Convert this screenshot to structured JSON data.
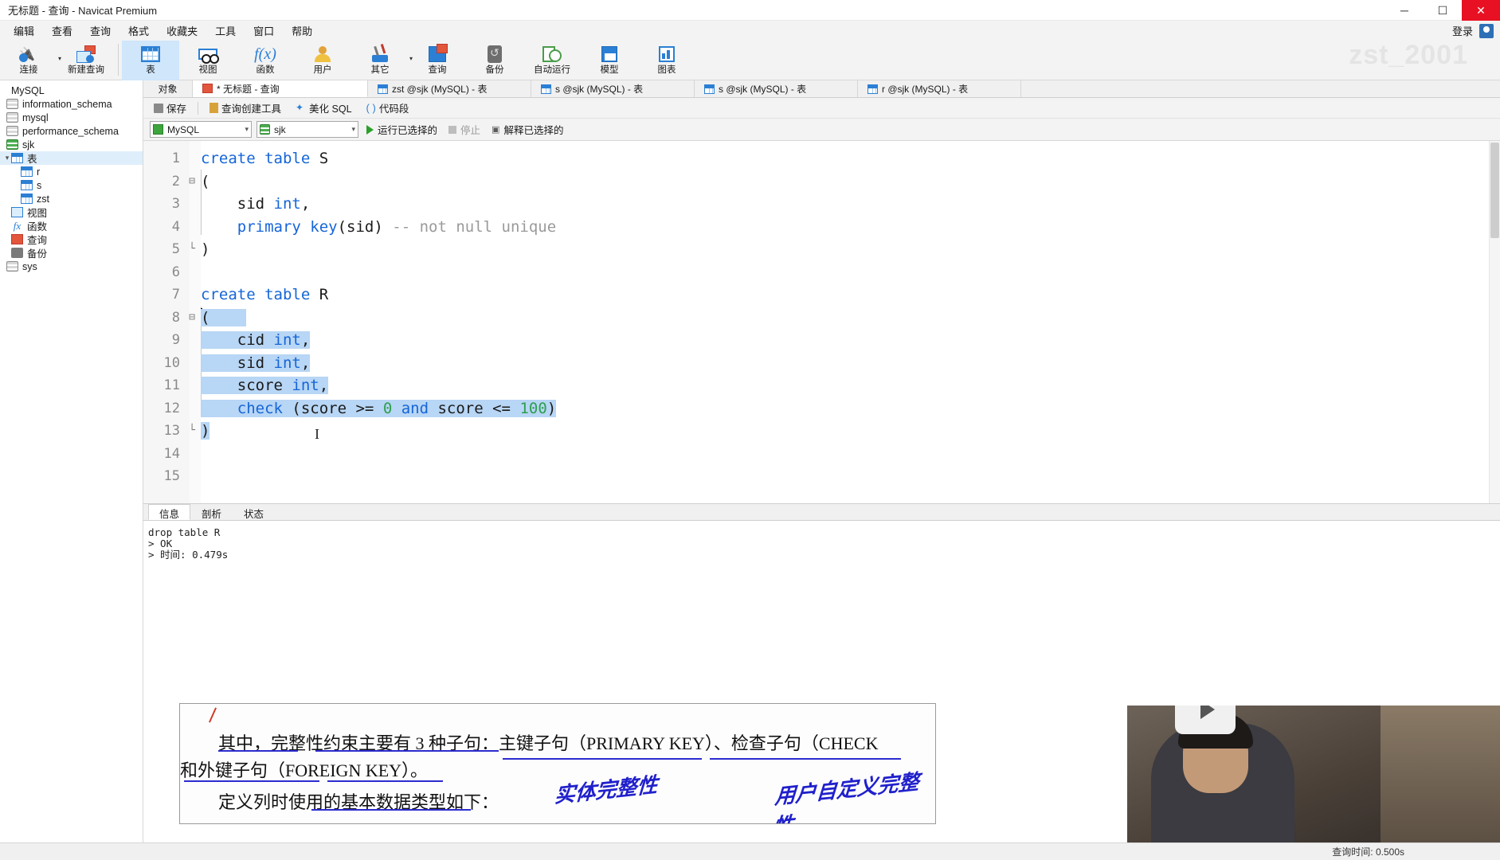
{
  "window": {
    "title": "无标题 - 查询 - Navicat Premium",
    "minimize": "─",
    "maximize": "☐",
    "close": "✕"
  },
  "menubar": {
    "items": [
      "编辑",
      "查看",
      "查询",
      "格式",
      "收藏夹",
      "工具",
      "窗口",
      "帮助"
    ],
    "login_label": "登录"
  },
  "ribbon": {
    "watermark": "zst_2001",
    "buttons": [
      {
        "label": "连接",
        "icon": "connection-icon",
        "has_caret": true
      },
      {
        "label": "新建查询",
        "icon": "new-query-icon",
        "has_caret": false
      },
      {
        "label": "表",
        "icon": "table-icon",
        "has_caret": false,
        "active": true
      },
      {
        "label": "视图",
        "icon": "view-icon",
        "has_caret": false
      },
      {
        "label": "函数",
        "icon": "function-icon",
        "has_caret": false
      },
      {
        "label": "用户",
        "icon": "user-icon",
        "has_caret": false
      },
      {
        "label": "其它",
        "icon": "other-icon",
        "has_caret": true
      },
      {
        "label": "查询",
        "icon": "query-icon",
        "has_caret": false
      },
      {
        "label": "备份",
        "icon": "backup-icon",
        "has_caret": false
      },
      {
        "label": "自动运行",
        "icon": "automation-icon",
        "has_caret": false
      },
      {
        "label": "模型",
        "icon": "model-icon",
        "has_caret": false
      },
      {
        "label": "图表",
        "icon": "chart-icon",
        "has_caret": false
      }
    ]
  },
  "sidebar": {
    "items": [
      {
        "label": "MySQL",
        "icon": "connection-icon",
        "indent": 0,
        "expander": ""
      },
      {
        "label": "information_schema",
        "icon": "database-icon",
        "indent": 1,
        "expander": ""
      },
      {
        "label": "mysql",
        "icon": "database-icon",
        "indent": 1,
        "expander": ""
      },
      {
        "label": "performance_schema",
        "icon": "database-icon",
        "indent": 1,
        "expander": ""
      },
      {
        "label": "sjk",
        "icon": "database-icon-active",
        "indent": 1,
        "expander": ""
      },
      {
        "label": "表",
        "icon": "table-folder-icon",
        "indent": 2,
        "expander": "▾",
        "selected": true
      },
      {
        "label": "r",
        "icon": "table-icon",
        "indent": 3,
        "expander": ""
      },
      {
        "label": "s",
        "icon": "table-icon",
        "indent": 3,
        "expander": ""
      },
      {
        "label": "zst",
        "icon": "table-icon",
        "indent": 3,
        "expander": ""
      },
      {
        "label": "视图",
        "icon": "view-icon",
        "indent": 2,
        "expander": ""
      },
      {
        "label": "函数",
        "icon": "function-icon",
        "indent": 2,
        "expander": ""
      },
      {
        "label": "查询",
        "icon": "query-icon",
        "indent": 2,
        "expander": ""
      },
      {
        "label": "备份",
        "icon": "backup-icon",
        "indent": 2,
        "expander": ""
      },
      {
        "label": "sys",
        "icon": "database-icon",
        "indent": 1,
        "expander": ""
      }
    ]
  },
  "tabstrip": {
    "object_tab": "对象",
    "tabs": [
      {
        "label": "* 无标题 - 查询",
        "icon": "query-tab-icon",
        "active": true
      },
      {
        "label": "zst @sjk (MySQL) - 表",
        "icon": "table-tab-icon",
        "active": false
      },
      {
        "label": "s @sjk (MySQL) - 表",
        "icon": "table-tab-icon",
        "active": false
      },
      {
        "label": "s @sjk (MySQL) - 表",
        "icon": "table-edit-tab-icon",
        "active": false
      },
      {
        "label": "r @sjk (MySQL) - 表",
        "icon": "table-tab-icon",
        "active": false
      }
    ]
  },
  "query_toolbar": {
    "save": "保存",
    "query_builder": "查询创建工具",
    "beautify_sql": "美化 SQL",
    "snippet": "代码段",
    "snippet_prefix": "( )"
  },
  "run_toolbar": {
    "connection_value": "MySQL",
    "database_value": "sjk",
    "run_selected": "运行已选择的",
    "stop": "停止",
    "explain_selected": "解释已选择的"
  },
  "editor": {
    "lines": [
      {
        "n": "1",
        "fold": "",
        "text": "create table S",
        "segments": [
          {
            "t": "create table ",
            "c": "kw"
          },
          {
            "t": "S",
            "c": ""
          }
        ]
      },
      {
        "n": "2",
        "fold": "⊟",
        "text": "(",
        "segments": [
          {
            "t": "(",
            "c": ""
          }
        ]
      },
      {
        "n": "3",
        "fold": "",
        "text": "    sid int,",
        "segments": [
          {
            "t": "    sid ",
            "c": ""
          },
          {
            "t": "int",
            "c": "kw"
          },
          {
            "t": ",",
            "c": ""
          }
        ]
      },
      {
        "n": "4",
        "fold": "",
        "text": "    primary key(sid) -- not null unique",
        "segments": [
          {
            "t": "    ",
            "c": ""
          },
          {
            "t": "primary key",
            "c": "kw"
          },
          {
            "t": "(sid) ",
            "c": ""
          },
          {
            "t": "-- not null unique",
            "c": "cmt"
          }
        ]
      },
      {
        "n": "5",
        "fold": "└",
        "text": ")",
        "segments": [
          {
            "t": ")",
            "c": ""
          }
        ]
      },
      {
        "n": "6",
        "fold": "",
        "text": "",
        "segments": []
      },
      {
        "n": "7",
        "fold": "",
        "text": "create table R",
        "segments": [
          {
            "t": "create table ",
            "c": "kw"
          },
          {
            "t": "R",
            "c": ""
          }
        ]
      },
      {
        "n": "8",
        "fold": "⊟",
        "text": "(",
        "segments": [
          {
            "t": "(",
            "c": "sel"
          }
        ]
      },
      {
        "n": "9",
        "fold": "",
        "text": "    cid int,",
        "segments": [
          {
            "t": "    cid ",
            "c": "sel"
          },
          {
            "t": "int",
            "c": "kw sel"
          },
          {
            "t": ",",
            "c": "sel"
          }
        ]
      },
      {
        "n": "10",
        "fold": "",
        "text": "    sid int,",
        "segments": [
          {
            "t": "    sid ",
            "c": "sel"
          },
          {
            "t": "int",
            "c": "kw sel"
          },
          {
            "t": ",",
            "c": "sel"
          }
        ]
      },
      {
        "n": "11",
        "fold": "",
        "text": "    score int,",
        "segments": [
          {
            "t": "    score ",
            "c": "sel"
          },
          {
            "t": "int",
            "c": "kw sel"
          },
          {
            "t": ",",
            "c": "sel"
          }
        ]
      },
      {
        "n": "12",
        "fold": "",
        "text": "    check (score >= 0 and score <= 100)",
        "segments": [
          {
            "t": "    ",
            "c": "sel"
          },
          {
            "t": "check",
            "c": "kw sel"
          },
          {
            "t": " (score >= ",
            "c": "sel"
          },
          {
            "t": "0",
            "c": "num-lit sel"
          },
          {
            "t": " ",
            "c": "sel"
          },
          {
            "t": "and",
            "c": "kw sel"
          },
          {
            "t": " score <= ",
            "c": "sel"
          },
          {
            "t": "100",
            "c": "num-lit sel"
          },
          {
            "t": ")",
            "c": "sel"
          }
        ]
      },
      {
        "n": "13",
        "fold": "└",
        "text": ")",
        "segments": [
          {
            "t": ")",
            "c": "sel"
          }
        ]
      },
      {
        "n": "14",
        "fold": "",
        "text": "",
        "segments": []
      },
      {
        "n": "15",
        "fold": "",
        "text": "",
        "segments": []
      }
    ]
  },
  "results": {
    "tabs": [
      "信息",
      "剖析",
      "状态"
    ],
    "active_tab": "信息",
    "output": "drop table R\n> OK\n> 时间: 0.479s"
  },
  "statusbar": {
    "query_time": "查询时间: 0.500s"
  },
  "doc_overlay": {
    "line1": "其中，完整性约束主要有 3 种子句：主键子句（PRIMARY KEY）、检查子句（CHECK",
    "line2": "和外键子句（FOREIGN KEY）。",
    "line3": "定义列时使用的基本数据类型如下：",
    "annotation1": "实体完整性",
    "annotation2": "用户自定义完整性"
  },
  "colors": {
    "accent": "#2b7fd4",
    "selection": "#b8d6f5",
    "keyword": "#1565d8",
    "comment": "#9a9a9a",
    "number": "#2e9e4f",
    "ribbon_active": "#cfe6fb",
    "close_button": "#e81123"
  }
}
